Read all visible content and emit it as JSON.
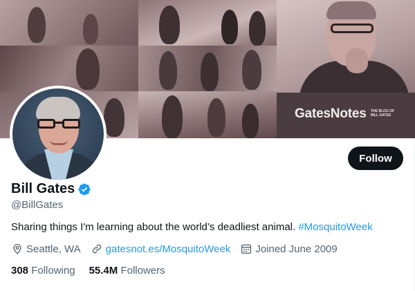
{
  "banner": {
    "brand_title": "GatesNotes",
    "brand_subtitle": "THE BLOG OF BILL GATES"
  },
  "profile": {
    "display_name": "Bill Gates",
    "handle": "@BillGates",
    "bio_text": "Sharing things I'm learning about the world’s deadliest animal. ",
    "bio_hashtag": "#MosquitoWeek",
    "verified": true
  },
  "actions": {
    "follow_label": "Follow"
  },
  "meta": {
    "location": "Seattle, WA",
    "website": "gatesnot.es/MosquitoWeek",
    "joined": "Joined June 2009"
  },
  "stats": {
    "following_count": "308",
    "following_label": "Following",
    "followers_count": "55.4M",
    "followers_label": "Followers"
  },
  "icons": {
    "verified": "verified-badge-icon",
    "location": "location-pin-icon",
    "link": "link-icon",
    "calendar": "calendar-icon"
  },
  "colors": {
    "accent": "#1d9bf0",
    "text_primary": "#0f1419",
    "text_secondary": "#536471",
    "button_bg": "#0f1419"
  }
}
